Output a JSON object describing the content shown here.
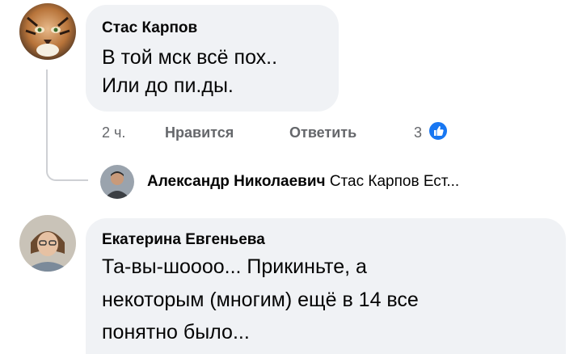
{
  "comments": [
    {
      "author": "Стас Карпов",
      "lines": [
        "В той мск всё пох..",
        "Или до пи.ды."
      ],
      "time": "2 ч.",
      "like_label": "Нравится",
      "reply_label": "Ответить",
      "reaction_count": "3",
      "reaction_icon": "like-icon",
      "avatar": "tiger-avatar"
    },
    {
      "author": "Екатерина Евгеньева",
      "lines": [
        "Та-вы-шоооо... Прикиньте, а",
        "некоторым (многим) ещё в 14 все",
        "понятно было..."
      ],
      "avatar": "woman-avatar"
    }
  ],
  "reply_preview": {
    "author": "Александр Николаевич",
    "snippet": "Стас Карпов Ест...",
    "avatar": "man-avatar"
  },
  "colors": {
    "bubble": "#f0f2f5",
    "meta": "#65676b",
    "like_blue": "#1877f2"
  }
}
